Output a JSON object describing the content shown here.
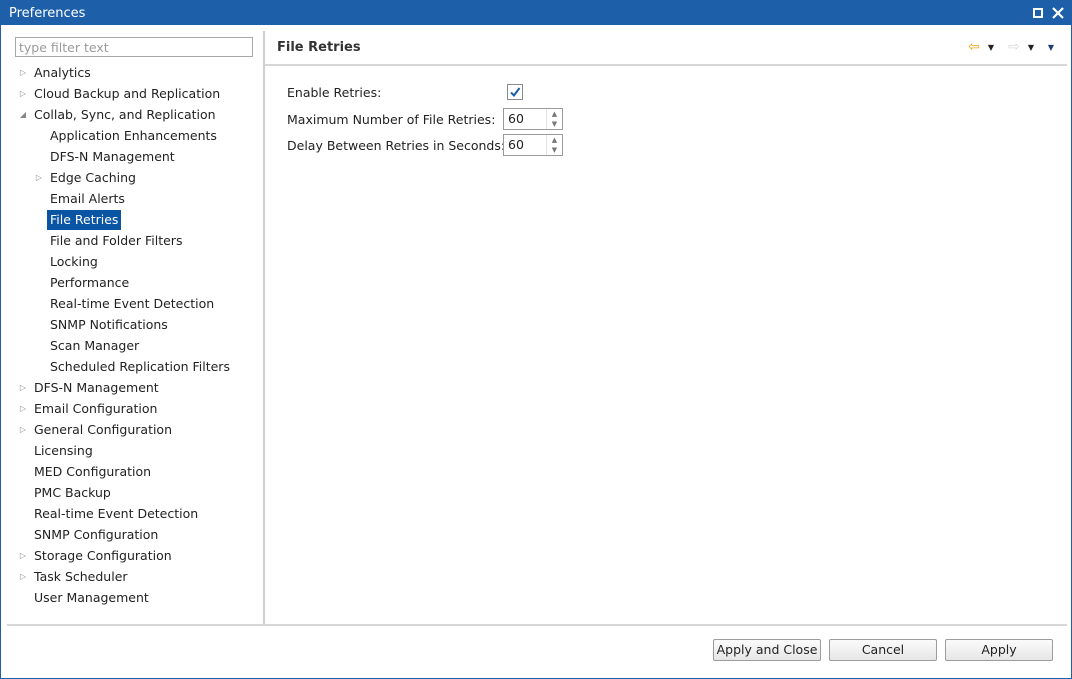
{
  "window": {
    "title": "Preferences"
  },
  "filter": {
    "placeholder": "type filter text"
  },
  "tree": [
    {
      "label": "Analytics",
      "level": 0,
      "arrow": "collapsed"
    },
    {
      "label": "Cloud Backup and Replication",
      "level": 0,
      "arrow": "collapsed"
    },
    {
      "label": "Collab, Sync, and Replication",
      "level": 0,
      "arrow": "expanded"
    },
    {
      "label": "Application Enhancements",
      "level": 1,
      "arrow": "none"
    },
    {
      "label": "DFS-N Management",
      "level": 1,
      "arrow": "none"
    },
    {
      "label": "Edge Caching",
      "level": 1,
      "arrow": "collapsed"
    },
    {
      "label": "Email Alerts",
      "level": 1,
      "arrow": "none"
    },
    {
      "label": "File Retries",
      "level": 1,
      "arrow": "none",
      "selected": true
    },
    {
      "label": "File and Folder Filters",
      "level": 1,
      "arrow": "none"
    },
    {
      "label": "Locking",
      "level": 1,
      "arrow": "none"
    },
    {
      "label": "Performance",
      "level": 1,
      "arrow": "none"
    },
    {
      "label": "Real-time Event Detection",
      "level": 1,
      "arrow": "none"
    },
    {
      "label": "SNMP Notifications",
      "level": 1,
      "arrow": "none"
    },
    {
      "label": "Scan Manager",
      "level": 1,
      "arrow": "none"
    },
    {
      "label": "Scheduled Replication Filters",
      "level": 1,
      "arrow": "none"
    },
    {
      "label": "DFS-N Management",
      "level": 0,
      "arrow": "collapsed"
    },
    {
      "label": "Email Configuration",
      "level": 0,
      "arrow": "collapsed"
    },
    {
      "label": "General Configuration",
      "level": 0,
      "arrow": "collapsed"
    },
    {
      "label": "Licensing",
      "level": 0,
      "arrow": "none"
    },
    {
      "label": "MED Configuration",
      "level": 0,
      "arrow": "none"
    },
    {
      "label": "PMC Backup",
      "level": 0,
      "arrow": "none"
    },
    {
      "label": "Real-time Event Detection",
      "level": 0,
      "arrow": "none"
    },
    {
      "label": "SNMP Configuration",
      "level": 0,
      "arrow": "none"
    },
    {
      "label": "Storage Configuration",
      "level": 0,
      "arrow": "collapsed"
    },
    {
      "label": "Task Scheduler",
      "level": 0,
      "arrow": "collapsed"
    },
    {
      "label": "User Management",
      "level": 0,
      "arrow": "none"
    }
  ],
  "page": {
    "title": "File Retries",
    "enable_label": "Enable Retries:",
    "enable_checked": true,
    "max_label": "Maximum Number of File Retries:",
    "max_value": "60",
    "delay_label": "Delay Between Retries in Seconds:",
    "delay_value": "60"
  },
  "buttons": {
    "apply_close": "Apply and Close",
    "cancel": "Cancel",
    "apply": "Apply"
  },
  "colors": {
    "titlebar": "#1d5fa8",
    "selection": "#0a55a3",
    "back_arrow": "#e8a21a"
  }
}
